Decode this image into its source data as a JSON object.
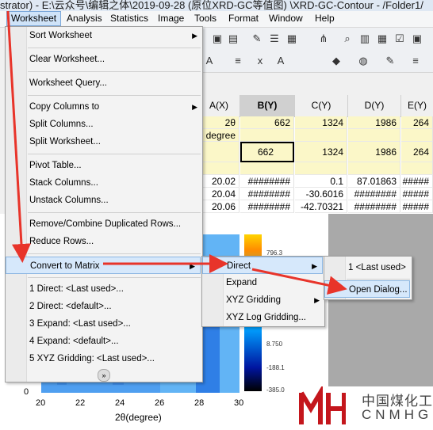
{
  "window": {
    "title": "strator) - E:\\云众号\\编辑之体\\2019-09-28 (原位XRD-GC等值图) \\XRD-GC-Contour - /Folder1/"
  },
  "menubar": [
    "Worksheet",
    "Analysis",
    "Statistics",
    "Image",
    "Tools",
    "Format",
    "Window",
    "Help"
  ],
  "sheet": {
    "headers": [
      "A(X)",
      "B(Y)",
      "C(Y)",
      "D(Y)",
      "E(Y)"
    ],
    "rows": [
      [
        "2θ",
        "662",
        "1324",
        "1986",
        "264"
      ],
      [
        "degree",
        "",
        "",
        "",
        ""
      ],
      [
        "",
        "662",
        "1324",
        "1986",
        "264"
      ],
      [
        "",
        "",
        "",
        "",
        ""
      ],
      [
        "20.02",
        "########",
        "0.1",
        "87.01863",
        "#####"
      ],
      [
        "20.04",
        "########",
        "-30.6016",
        "########",
        "#####"
      ],
      [
        "20.06",
        "########",
        "-42.70321",
        "########",
        "#####"
      ]
    ]
  },
  "graph": {
    "yticks": [
      "0"
    ],
    "xticks": [
      "20",
      "22",
      "24",
      "26",
      "28",
      "30"
    ],
    "xlabel": "2θ(degree)",
    "colorbar": [
      "796.3",
      "8.750",
      "-188.1",
      "-385.0"
    ]
  },
  "worksheet_menu": [
    {
      "label": "Sort Worksheet",
      "arrow": true
    },
    {
      "label": "Clear Worksheet..."
    },
    {
      "label": "Worksheet Query..."
    },
    {
      "label": "Copy Columns to",
      "arrow": true
    },
    {
      "label": "Split Columns..."
    },
    {
      "label": "Split Worksheet..."
    },
    {
      "label": "Pivot Table..."
    },
    {
      "label": "Stack Columns..."
    },
    {
      "label": "Unstack Columns..."
    },
    {
      "label": "Remove/Combine Duplicated Rows..."
    },
    {
      "label": "Reduce Rows..."
    },
    {
      "label": "Convert to Matrix",
      "arrow": true
    },
    {
      "label": "1 Direct: <Last used>..."
    },
    {
      "label": "2 Direct: <default>..."
    },
    {
      "label": "3 Expand: <Last used>..."
    },
    {
      "label": "4 Expand: <default>..."
    },
    {
      "label": "5 XYZ Gridding: <Last used>..."
    }
  ],
  "convert_menu": [
    {
      "label": "Direct",
      "arrow": true
    },
    {
      "label": "Expand",
      "arrow": false
    },
    {
      "label": "XYZ Gridding",
      "arrow": true
    },
    {
      "label": "XYZ Log Gridding..."
    }
  ],
  "direct_menu": [
    {
      "label": "1 <Last used>"
    },
    {
      "label": "Open Dialog..."
    }
  ],
  "logo": {
    "cn": "中国煤化工",
    "en": "CNMHG"
  },
  "colors": {
    "arrow": "#e8342a",
    "highlight": "#d6e8fb"
  }
}
